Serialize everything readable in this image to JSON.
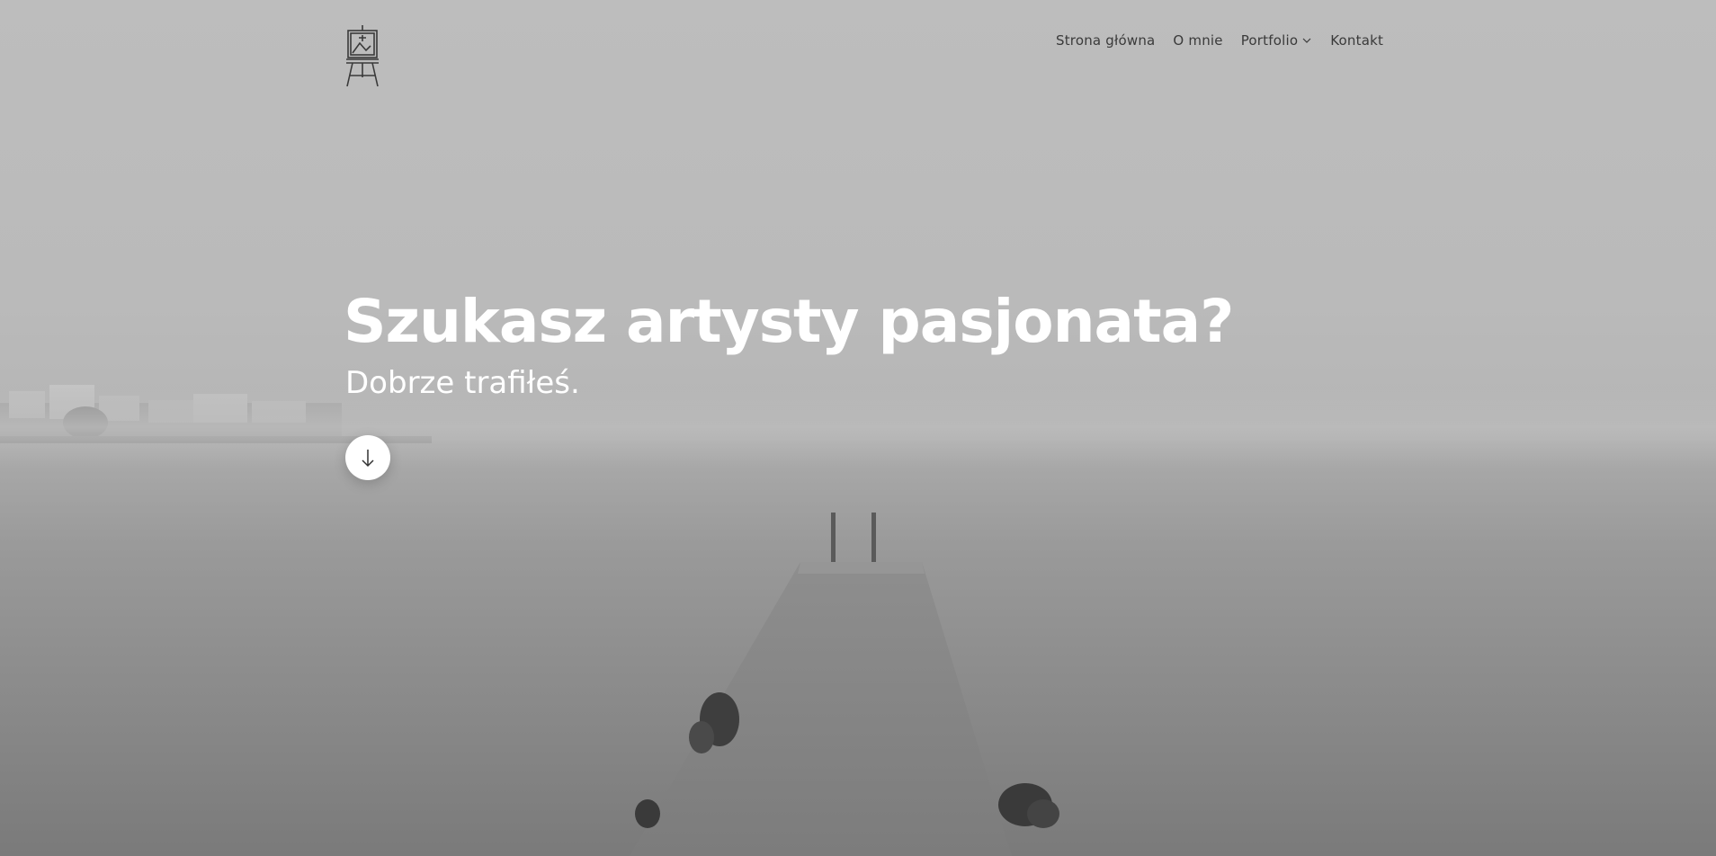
{
  "header": {
    "logo_icon": "easel-icon",
    "nav": [
      {
        "label": "Strona główna"
      },
      {
        "label": "O mnie"
      },
      {
        "label": "Portfolio",
        "has_dropdown": true
      },
      {
        "label": "Kontakt"
      }
    ]
  },
  "hero": {
    "headline": "Szukasz artysty pasjonata?",
    "subheadline": "Dobrze trafiłeś.",
    "scroll_button_icon": "arrow-down-icon",
    "background_image": "foggy-sea-pier-photo"
  },
  "colors": {
    "text_light": "#ffffff",
    "nav_text": "#3a3a3a"
  }
}
